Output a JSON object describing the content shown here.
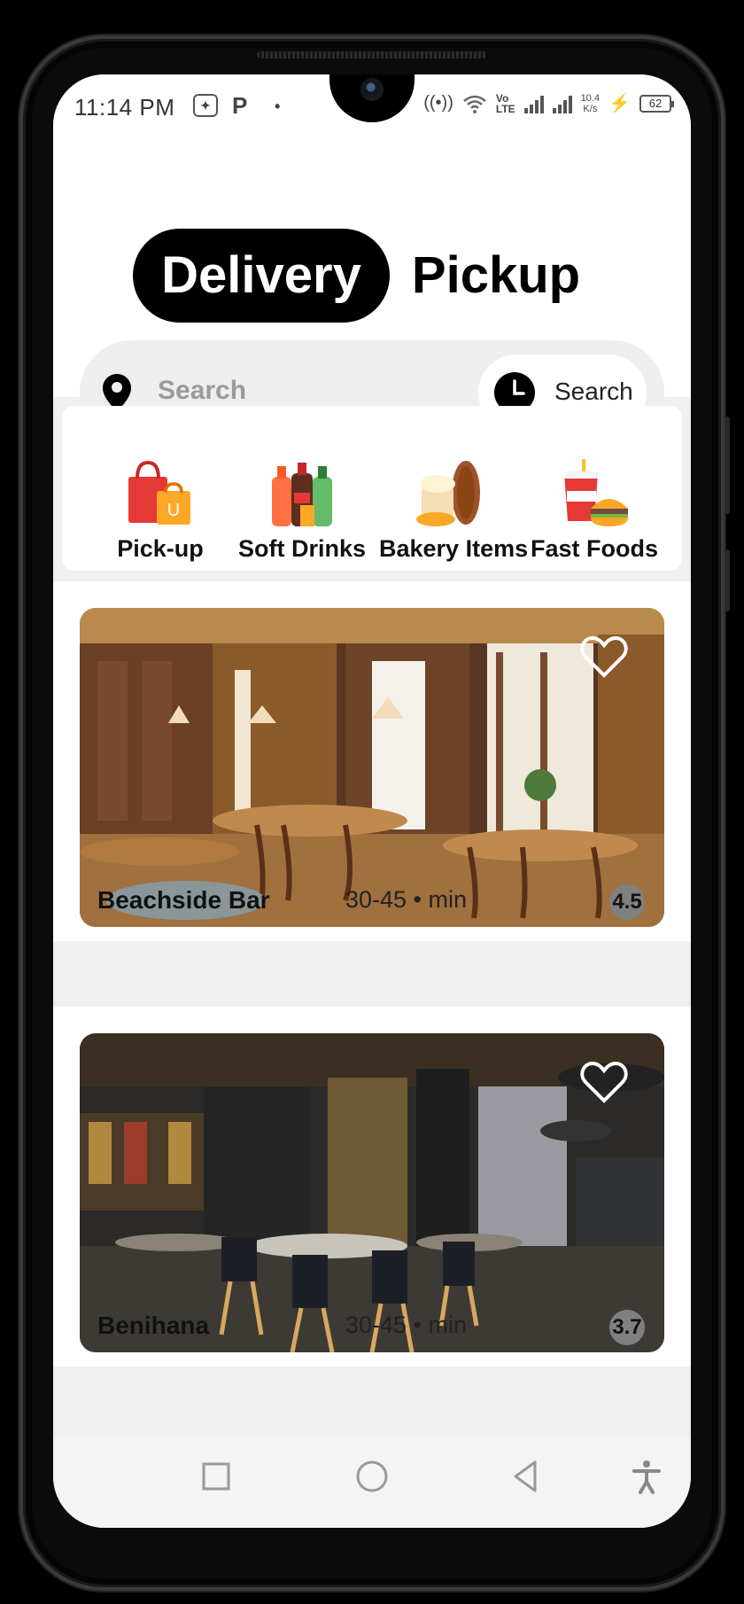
{
  "status_bar": {
    "time": "11:14 PM",
    "net_speed_value": "10.4",
    "net_speed_unit": "K/s",
    "volte_top": "Vo",
    "volte_bottom": "LTE",
    "battery": "62"
  },
  "header": {
    "tabs": [
      {
        "label": "Delivery",
        "active": true
      },
      {
        "label": "Pickup",
        "active": false
      }
    ],
    "search": {
      "placeholder": "Search",
      "button_label": "Search"
    }
  },
  "categories": [
    {
      "label": "Pick-up",
      "icon": "shopping-bags-icon"
    },
    {
      "label": "Soft Drinks",
      "icon": "soft-drinks-icon"
    },
    {
      "label": "Bakery Items",
      "icon": "bakery-icon"
    },
    {
      "label": "Fast Foods",
      "icon": "fast-food-icon"
    }
  ],
  "restaurants": [
    {
      "name": "Beachside Bar",
      "time": "30-45 • min",
      "rating": "4.5",
      "favorited": false
    },
    {
      "name": "Benihana",
      "time": "30-45 • min",
      "rating": "3.7",
      "favorited": false
    }
  ],
  "nav_bar": {
    "items": [
      "recent-apps-icon",
      "home-icon",
      "back-icon",
      "accessibility-icon"
    ]
  },
  "colors": {
    "accent": "#000000",
    "screen_background": "#f0f0f0",
    "search_background": "#eeeeee",
    "rating_badge": "#808080"
  }
}
